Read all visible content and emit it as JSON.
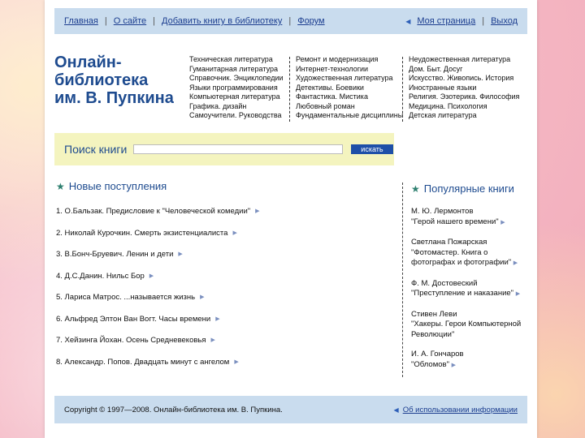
{
  "topbar": {
    "nav": [
      "Главная",
      "О сайте",
      "Добавить книгу в библиотеку",
      "Форум"
    ],
    "my_page": "Моя страница",
    "logout": "Выход"
  },
  "logo": {
    "line1": "Онлайн-библиотека",
    "line2": "им. В. Пупкина"
  },
  "categories": [
    [
      "Техническая литература",
      "Гуманитарная литература",
      "Справочник. Энциклопедии",
      "Языки программирования",
      "Компьютерная литература",
      "Графика. дизайн",
      "Самоучители. Руководства"
    ],
    [
      "Ремонт и модернизация",
      "Интернет-технологии",
      "Художественная литература",
      "Детективы. Боевики",
      "Фантастика. Мистика",
      "Любовный роман",
      "Фундаментальные дисциплины"
    ],
    [
      "Неудожественная литература",
      "Дом. Быт. Досуг",
      "Искусство. Живопись. История",
      "Иностранные языки",
      "Религия. Эзотерика. Философия",
      "Медицина. Психология",
      "Детская литература"
    ]
  ],
  "search": {
    "label": "Поиск книги",
    "button": "искать"
  },
  "new_arrivals": {
    "title": "Новые поступления",
    "items": [
      "1. О.Бальзак. Предисловие к \"Человеческой комедии\"",
      "2. Николай Курочкин. Смерть экзистенциалиста",
      "3. В.Бонч-Бруевич. Ленин и дети",
      "4. Д.С.Данин. Нильс Бор",
      "5. Лариса Матрос. ...называется жизнь",
      "6. Альфред Элтон Ван Вогт. Часы времени",
      "7. Хейзинга Йохан. Осень Средневековья",
      "8. Александр. Попов. Двадцать минут с ангелом"
    ]
  },
  "popular": {
    "title": "Популярные книги",
    "items": [
      {
        "author": "М. Ю. Лермонтов",
        "title": "\"Герой нашего времени\""
      },
      {
        "author": "Светлана Пожарская",
        "title": "\"Фотомастер. Книга о фотографах и фотографии\""
      },
      {
        "author": "Ф. М. Достовеский",
        "title": "\"Преступление и наказание\""
      },
      {
        "author": "Стивен Леви",
        "title": "\"Хакеры. Герои Компьютерной Революции\""
      },
      {
        "author": "И. А. Гончаров",
        "title": "\"Обломов\""
      }
    ]
  },
  "footer": {
    "copyright": "Copyright © 1997—2008. Онлайн-библиотека им. В. Пупкина.",
    "info_link": "Об использовании информации"
  }
}
